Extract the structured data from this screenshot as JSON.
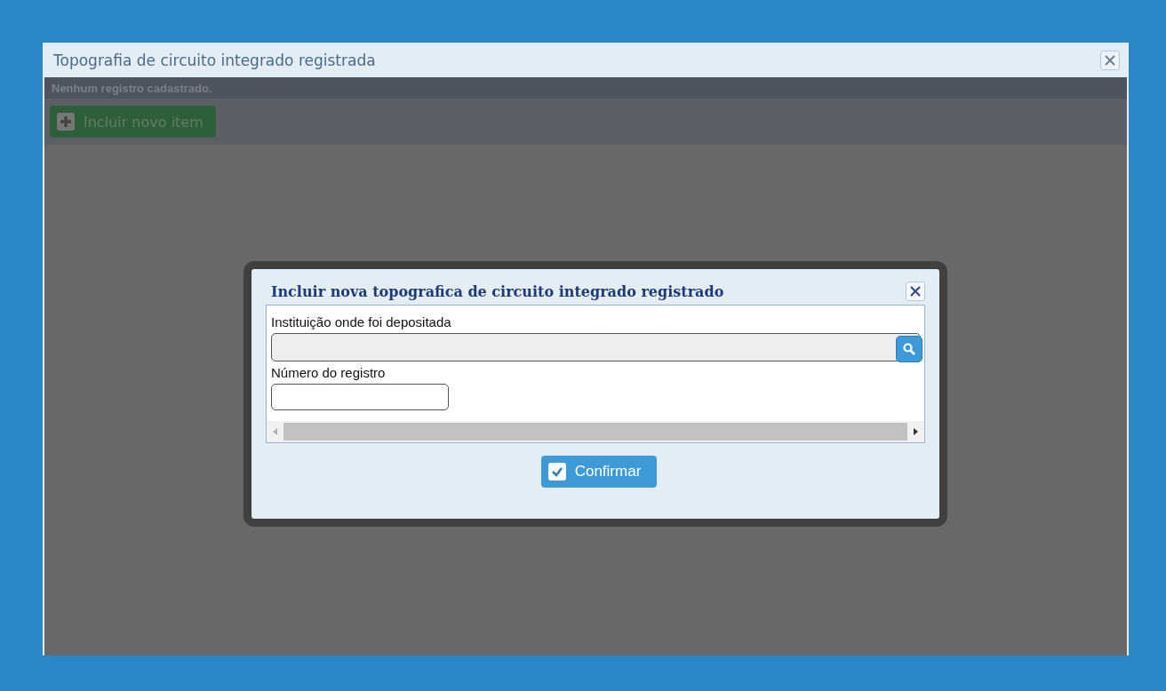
{
  "window": {
    "title": "Topografia de circuito integrado registrada"
  },
  "message": "Nenhum registro cadastrado.",
  "toolbar": {
    "add_button": "Incluir novo item"
  },
  "dialog": {
    "title": "Incluir nova topografica de circuito integrado registrado",
    "fields": [
      {
        "label": "Instituição onde foi depositada",
        "kind": "lookup",
        "disabled": true
      },
      {
        "label": "Número do registro",
        "kind": "text",
        "disabled": false
      }
    ],
    "confirm_button": "Confirmar"
  }
}
